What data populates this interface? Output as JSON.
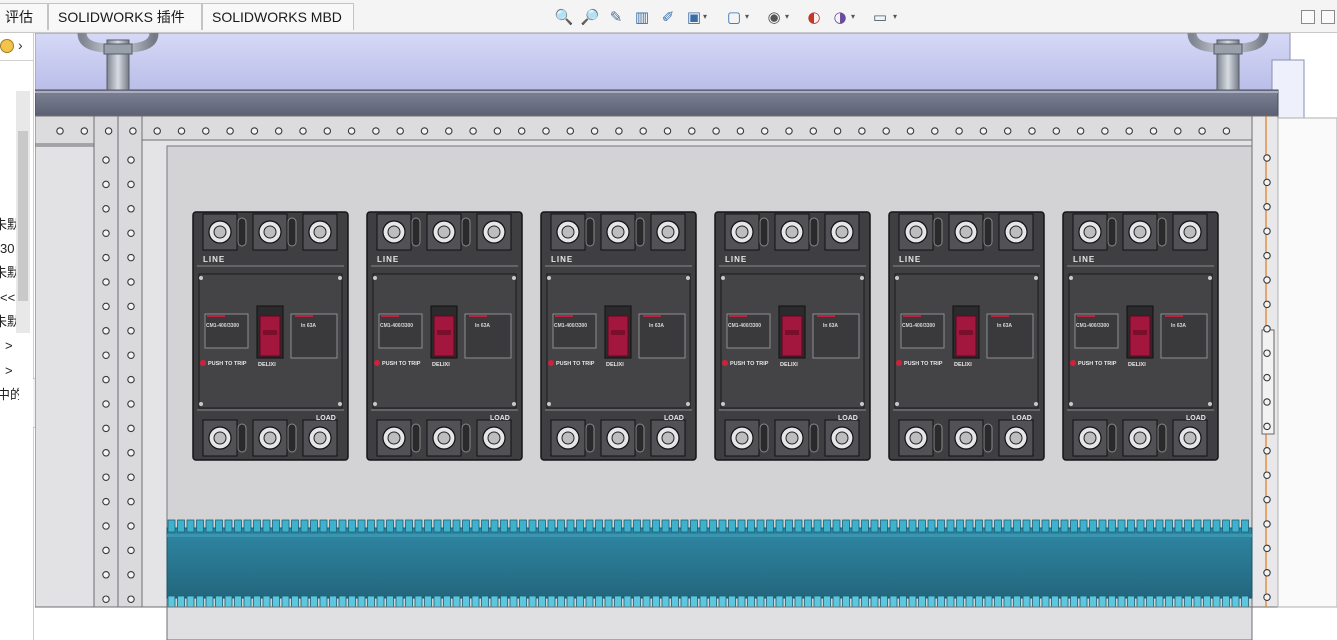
{
  "command_manager": {
    "tabs": [
      {
        "label": "评估"
      },
      {
        "label": "SOLIDWORKS 插件"
      },
      {
        "label": "SOLIDWORKS MBD"
      }
    ]
  },
  "view_toolbar": {
    "icons": [
      "zoom-to-fit-icon",
      "zoom-to-area-icon",
      "previous-view-icon",
      "section-view-icon",
      "dynamic-annotation-view-icon",
      "view-orientation-icon",
      "display-style-icon",
      "hide-show-items-icon",
      "edit-appearance-icon",
      "apply-scene-icon",
      "view-settings-icon"
    ]
  },
  "feature_tree": {
    "fragments": [
      "朱默",
      "30",
      "朱默",
      "<<",
      "朱默",
      ">",
      ">",
      "中的"
    ]
  },
  "model": {
    "breakers": [
      {
        "top_label": "LINE",
        "bottom_label": "LOAD",
        "rating_label": "CM1-400/3300",
        "current_label": "In 63A",
        "push_label": "PUSH TO TRIP",
        "brand_label": "DELIXI"
      },
      {
        "top_label": "LINE",
        "bottom_label": "LOAD",
        "rating_label": "CM1-400/3300",
        "current_label": "In 63A",
        "push_label": "PUSH TO TRIP",
        "brand_label": "DELIXI"
      },
      {
        "top_label": "LINE",
        "bottom_label": "LOAD",
        "rating_label": "CM1-400/3300",
        "current_label": "In 63A",
        "push_label": "PUSH TO TRIP",
        "brand_label": "DELIXI"
      },
      {
        "top_label": "LINE",
        "bottom_label": "LOAD",
        "rating_label": "CM1-400/3300",
        "current_label": "In 63A",
        "push_label": "PUSH TO TRIP",
        "brand_label": "DELIXI"
      },
      {
        "top_label": "LINE",
        "bottom_label": "LOAD",
        "rating_label": "CM1-400/3300",
        "current_label": "In 63A",
        "push_label": "PUSH TO TRIP",
        "brand_label": "DELIXI"
      },
      {
        "top_label": "LINE",
        "bottom_label": "LOAD",
        "rating_label": "CM1-400/3300",
        "current_label": "In 63A",
        "push_label": "PUSH TO TRIP",
        "brand_label": "DELIXI"
      }
    ],
    "colors": {
      "cabinet_roof": "#c9cdf0",
      "cabinet_frame": "#d7d7d9",
      "mounting_plate": "#d3d3d5",
      "breaker_body": "#3f3f42",
      "breaker_handle": "#a3163e",
      "cable_duct": "#2c7b96",
      "duct_teeth": "#5bc8e0"
    }
  }
}
